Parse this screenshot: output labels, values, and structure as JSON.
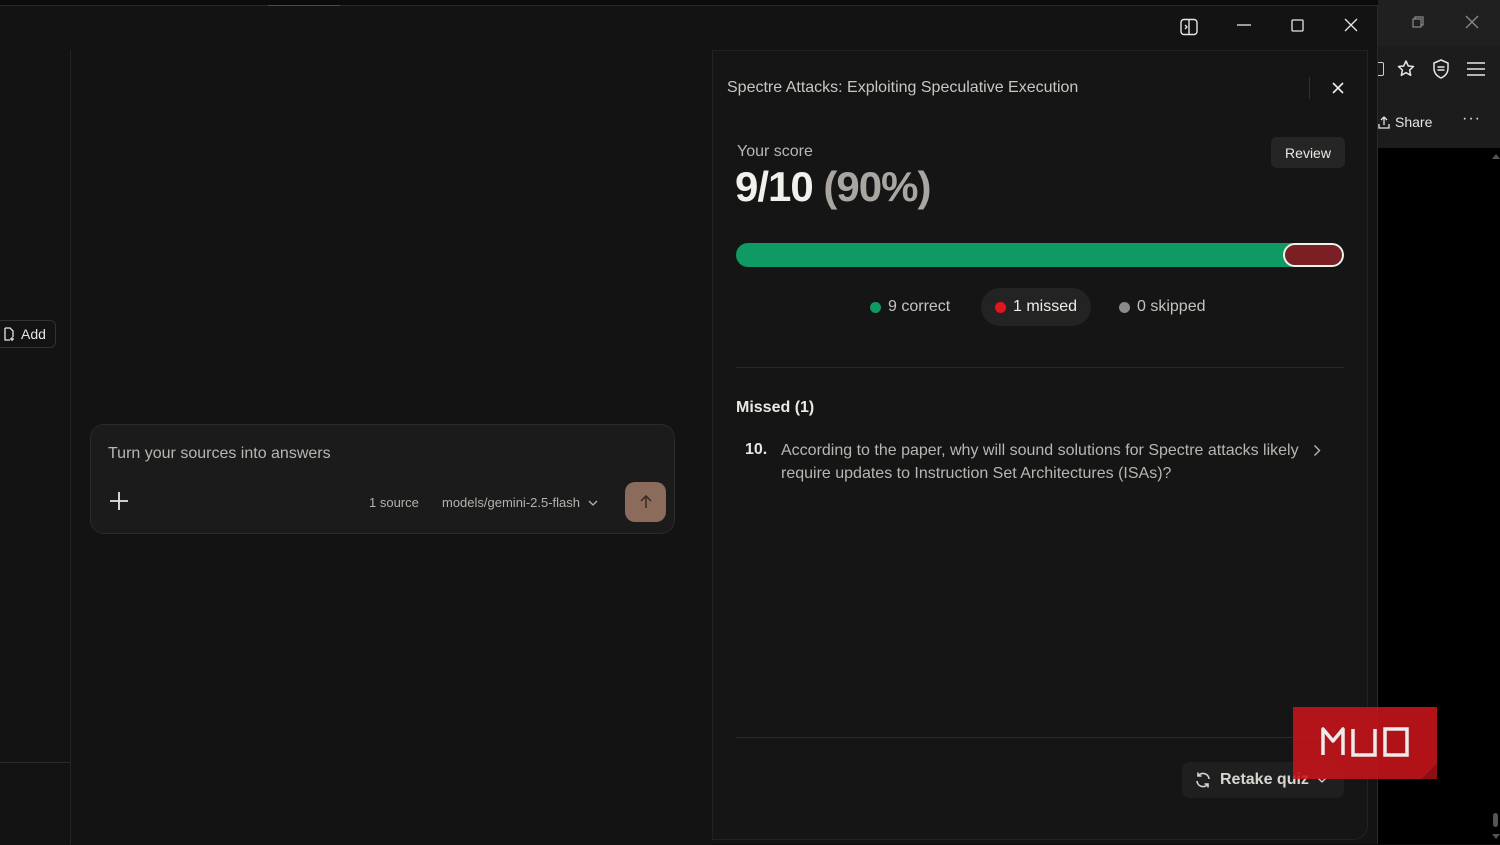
{
  "background_browser": {
    "share_label": "Share",
    "more_label": "···"
  },
  "left_rail": {
    "add_label": "Add"
  },
  "chat": {
    "placeholder": "Turn your sources into answers",
    "source_count": "1 source",
    "model": "models/gemini-2.5-flash"
  },
  "quiz": {
    "title": "Spectre Attacks: Exploiting Speculative Execution",
    "score_label": "Your score",
    "score": "9/10",
    "score_percent": "(90%)",
    "review_label": "Review",
    "progress": {
      "correct_fraction": 0.9,
      "missed_fraction": 0.1
    },
    "stats": {
      "correct": "9 correct",
      "missed": "1 missed",
      "skipped": "0 skipped"
    },
    "missed_heading": "Missed (1)",
    "missed_items": [
      {
        "number": "10.",
        "question": "According to the paper, why will sound solutions for Spectre attacks likely require updates to Instruction Set Architectures (ISAs)?"
      }
    ],
    "retake_label": "Retake quiz"
  },
  "colors": {
    "correct": "#0e9a62",
    "missed": "#e0161e",
    "skipped": "#8a8a8a",
    "send_button": "#8a6b5c",
    "logo": "#c8151b"
  },
  "logo": {
    "text": "MUO"
  }
}
